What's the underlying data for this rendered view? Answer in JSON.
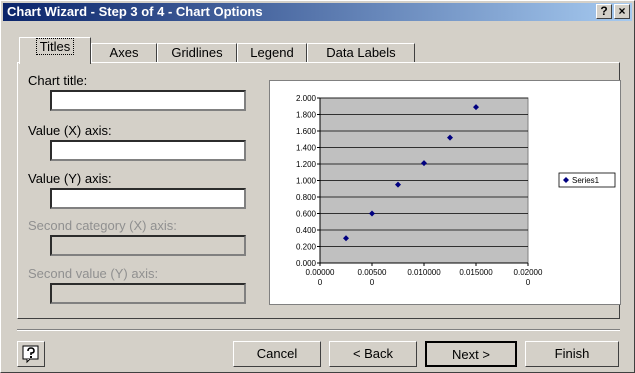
{
  "window": {
    "title": "Chart Wizard - Step 3 of 4 - Chart Options",
    "help_glyph": "?",
    "close_glyph": "×"
  },
  "tabs": [
    "Titles",
    "Axes",
    "Gridlines",
    "Legend",
    "Data Labels"
  ],
  "fields": {
    "chart_title": {
      "label": "Chart title:",
      "value": ""
    },
    "value_x_axis": {
      "label": "Value (X) axis:",
      "value": ""
    },
    "value_y_axis": {
      "label": "Value (Y) axis:",
      "value": ""
    },
    "second_category_x_axis": {
      "label": "Second category (X) axis:",
      "value": ""
    },
    "second_value_y_axis": {
      "label": "Second value (Y) axis:",
      "value": ""
    }
  },
  "buttons": {
    "cancel": "Cancel",
    "back": "< Back",
    "next": "Next >",
    "finish": "Finish"
  },
  "chart_data": {
    "type": "scatter",
    "series": [
      {
        "name": "Series1",
        "x": [
          0.0025,
          0.005,
          0.0075,
          0.01,
          0.0125,
          0.015
        ],
        "y": [
          0.3,
          0.6,
          0.95,
          1.21,
          1.52,
          1.89
        ]
      }
    ],
    "xlim": [
      0,
      0.02
    ],
    "ylim": [
      0,
      2
    ],
    "y_ticks": [
      "0.000",
      "0.200",
      "0.400",
      "0.600",
      "0.800",
      "1.000",
      "1.200",
      "1.400",
      "1.600",
      "1.800",
      "2.000"
    ],
    "x_ticks": [
      {
        "l1": "0.00000",
        "l2": "0"
      },
      {
        "l1": "0.00500",
        "l2": "0"
      },
      {
        "l1": "0.010000",
        "l2": ""
      },
      {
        "l1": "0.015000",
        "l2": ""
      },
      {
        "l1": "0.02000",
        "l2": "0"
      }
    ],
    "grid": true,
    "plot_color": "#c0c0c0",
    "marker_color": "#000080",
    "legend": "right"
  }
}
